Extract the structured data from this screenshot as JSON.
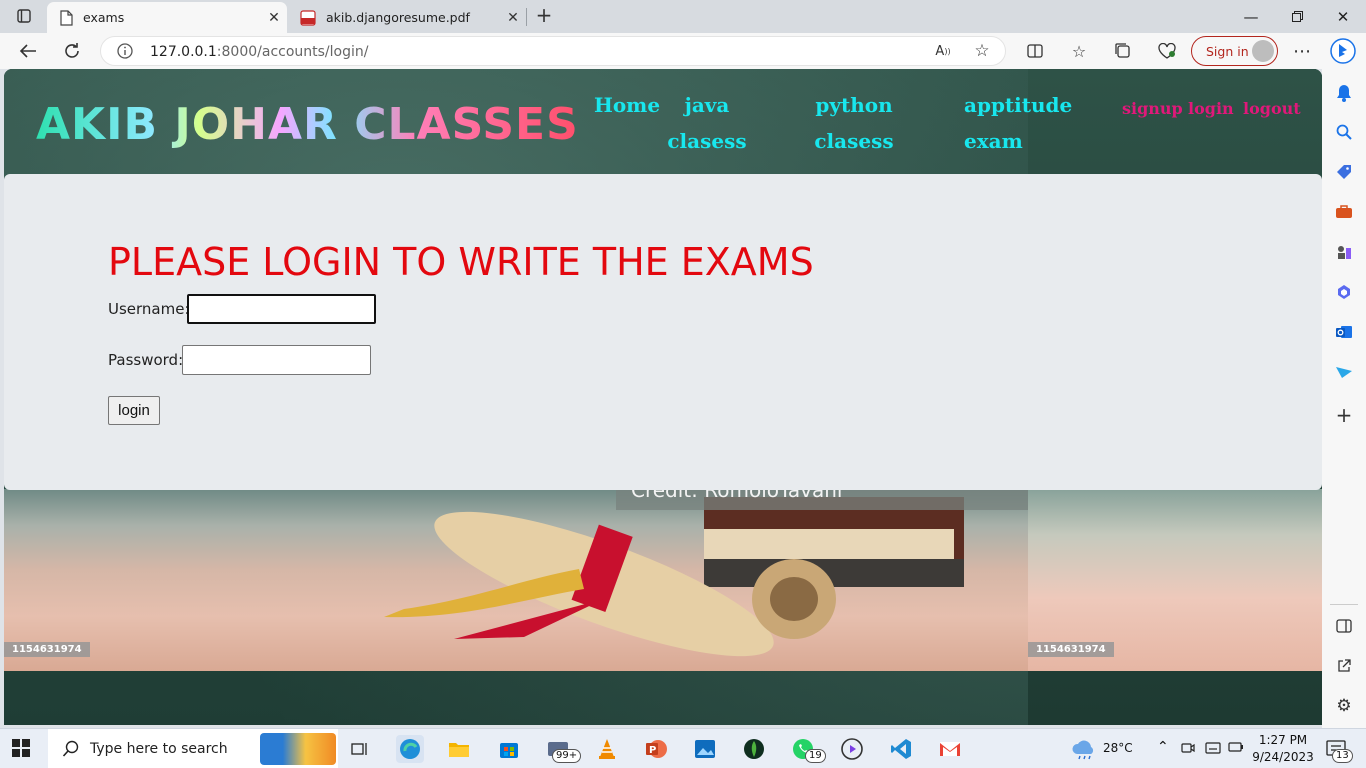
{
  "browser": {
    "tabs": [
      {
        "title": "exams",
        "active": true
      },
      {
        "title": "akib.djangoresume.pdf",
        "active": false
      }
    ],
    "url_host": "127.0.0.1",
    "url_rest": ":8000/accounts/login/",
    "sign_in_label": "Sign in"
  },
  "site": {
    "brand": "AKIB JOHAR CLASSES",
    "nav": [
      {
        "label": "Home"
      },
      {
        "label": "java clasess"
      },
      {
        "label": "python clasess"
      },
      {
        "label": "apptitude exam"
      }
    ],
    "auth_links": [
      {
        "label": "signup"
      },
      {
        "label": "login"
      },
      {
        "label": "logout"
      }
    ],
    "photo_credit": "Credit: RomoloTavani",
    "photo_ids": [
      "1154631974",
      "1154631974"
    ]
  },
  "login": {
    "heading": "PLEASE LOGIN TO WRITE THE EXAMS",
    "username_label": "Username:",
    "username_value": "",
    "password_label": "Password:",
    "password_value": "",
    "submit_label": "login"
  },
  "taskbar": {
    "search_placeholder": "Type here to search",
    "explorer_badge": "99+",
    "whatsapp_badge": "19",
    "weather": "28°C",
    "time": "1:27 PM",
    "date": "9/24/2023",
    "notifications": "13"
  },
  "colors": {
    "heading": "#e3080f",
    "nav": "#18e7ee",
    "auth": "#e0187a"
  }
}
